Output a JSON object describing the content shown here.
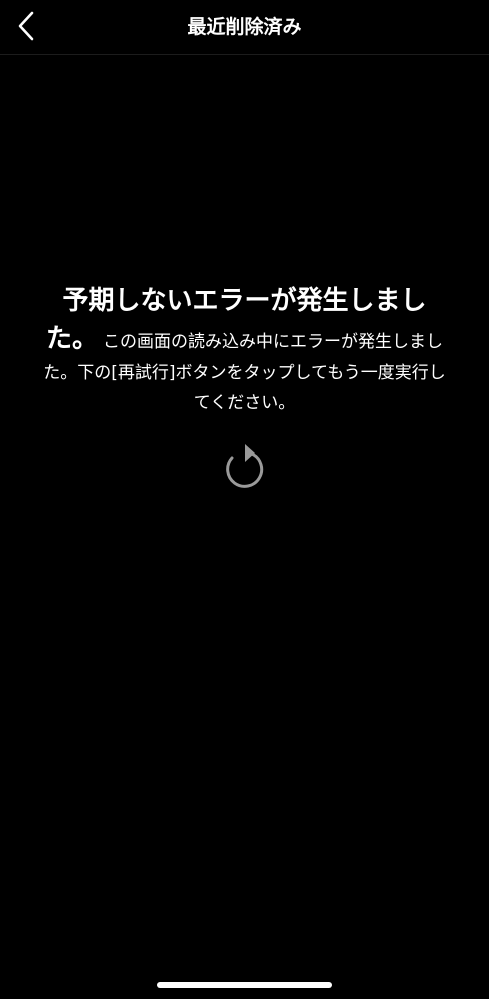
{
  "header": {
    "title": "最近削除済み",
    "back_icon": "chevron-left-icon"
  },
  "error": {
    "title": "予期しないエラーが発生しました。",
    "message": "この画面の読み込み中にエラーが発生しました。下の[再試行]ボタンをタップしてもう一度実行してください。",
    "retry_icon": "refresh-icon"
  },
  "colors": {
    "background": "#000000",
    "text": "#ffffff",
    "icon": "#9a9a9a"
  }
}
